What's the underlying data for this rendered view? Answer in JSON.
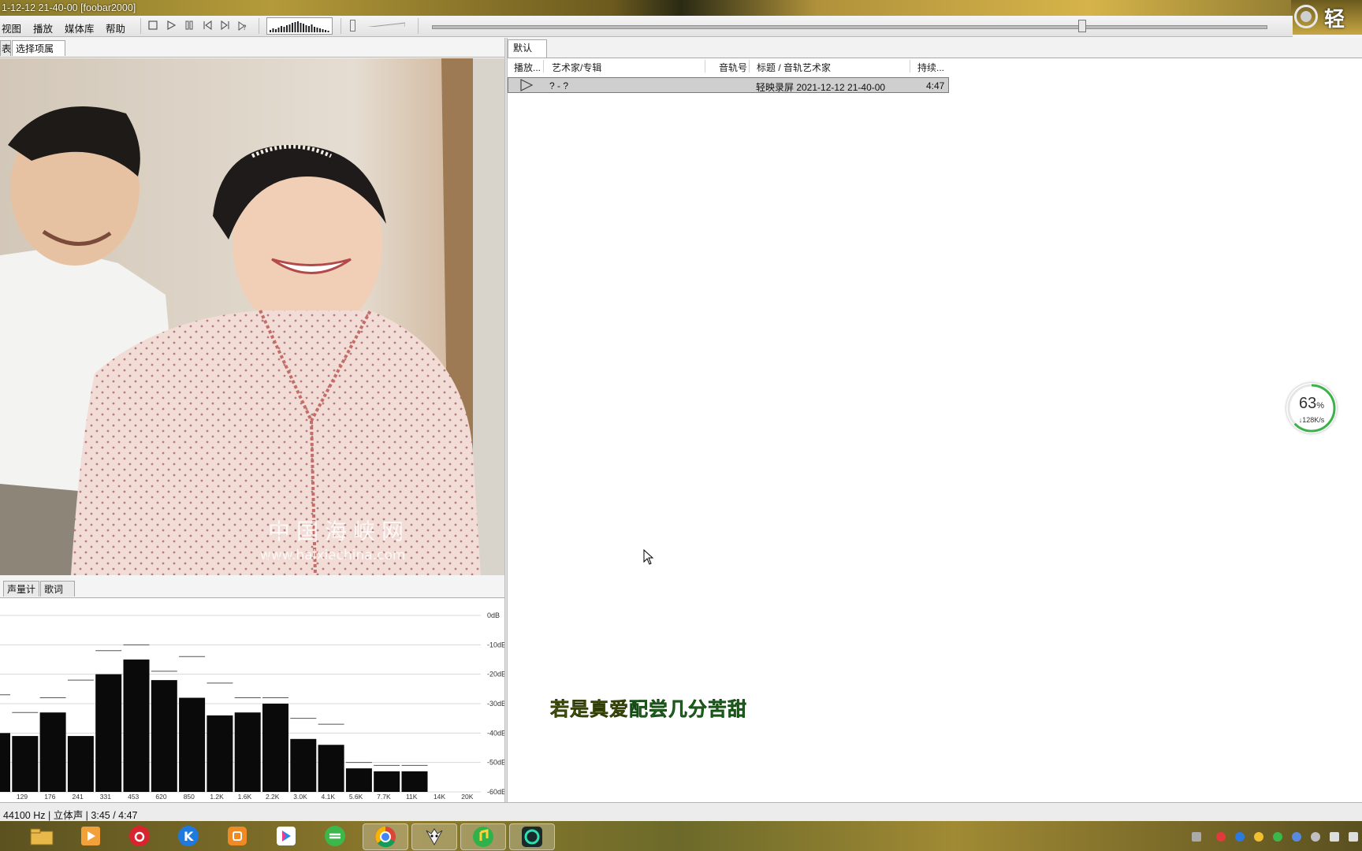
{
  "window": {
    "title": "1-12-12 21-40-00  [foobar2000]"
  },
  "brand_text": "轻",
  "menu": [
    "视图",
    "播放",
    "媒体库",
    "帮助"
  ],
  "toolbar": {
    "stop_icon": "stop-icon",
    "play_icon": "play-icon",
    "pause_icon": "pause-icon",
    "prev_icon": "previous-icon",
    "next_icon": "next-icon",
    "random_icon": "random-icon"
  },
  "seek": {
    "position_fraction": 0.78
  },
  "left_tabs": [
    "表",
    "选择项属性"
  ],
  "vis_tabs": [
    "声量计",
    "歌词"
  ],
  "spectrum": {
    "db_labels": [
      "0dB",
      "-10dB",
      "-20dB",
      "-30dB",
      "-40dB",
      "-50dB",
      "-60dB"
    ],
    "freq_labels": [
      "129",
      "176",
      "241",
      "331",
      "453",
      "620",
      "850",
      "1.2K",
      "1.6K",
      "2.2K",
      "3.0K",
      "4.1K",
      "5.6K",
      "7.7K",
      "11K",
      "14K",
      "20K"
    ],
    "bars_db": [
      -40,
      -41,
      -33,
      -41,
      -20,
      -15,
      -22,
      -28,
      -34,
      -33,
      -30,
      -42,
      -44,
      -52,
      -53,
      -53
    ],
    "peaks_db": [
      -27,
      -33,
      -28,
      -22,
      -12,
      -10,
      -19,
      -14,
      -23,
      -28,
      -28,
      -35,
      -37,
      -50,
      -51,
      -51
    ]
  },
  "artwork": {
    "watermark_line1": "中国海峡网",
    "watermark_line2": "www.haixiachina.com"
  },
  "playlist": {
    "tab": "默认",
    "columns": [
      "播放...",
      "艺术家/专辑",
      "音轨号",
      "标题 / 音轨艺术家",
      "持续..."
    ],
    "rows": [
      {
        "play_icon": "play-triangle-icon",
        "artist": "? - ?",
        "track": "",
        "title": "轻映录屏 2021-12-12 21-40-00",
        "duration": "4:47"
      }
    ]
  },
  "lyric": {
    "sung": "若是真爱",
    "unsung": "配尝几分苦甜"
  },
  "net_widget": {
    "percent": "63",
    "percent_unit": "%",
    "speed": "↓128K/s"
  },
  "status": "44100 Hz | 立体声 | 3:45 / 4:47",
  "taskbar": {
    "apps": [
      "file-explorer-icon",
      "media-player-icon",
      "netease-music-icon",
      "kugou-icon",
      "orange-app-icon",
      "youku-icon",
      "green-app-icon",
      "chrome-icon",
      "foobar-icon",
      "music-app-icon",
      "screen-recorder-icon"
    ]
  },
  "colors": {
    "accent_green": "#2c8a2a",
    "lyric_sung": "#6a7a10",
    "taskbar": "#8c7a2c"
  }
}
